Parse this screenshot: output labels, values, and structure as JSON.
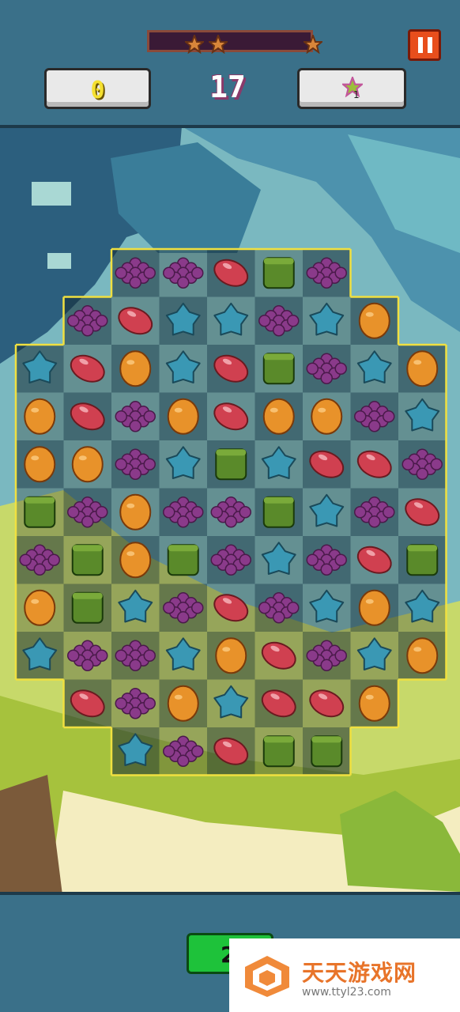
{
  "hud": {
    "coins": "0",
    "moves_left": "17",
    "booster_count": "1",
    "stars_total": 3
  },
  "board": {
    "rows": [
      [
        "",
        "",
        "grape",
        "grape",
        "bean",
        "square",
        "grape",
        "",
        ""
      ],
      [
        "",
        "grape",
        "bean",
        "star",
        "star",
        "grape",
        "star",
        "orange",
        ""
      ],
      [
        "star",
        "bean",
        "orange",
        "star",
        "bean",
        "square",
        "grape",
        "star",
        "orange"
      ],
      [
        "orange",
        "bean",
        "grape",
        "orange",
        "bean",
        "orange",
        "orange",
        "grape",
        "star"
      ],
      [
        "orange",
        "orange",
        "grape",
        "star",
        "square",
        "star",
        "bean",
        "bean",
        "grape"
      ],
      [
        "square",
        "grape",
        "orange",
        "grape",
        "grape",
        "square",
        "star",
        "grape",
        "bean"
      ],
      [
        "grape",
        "square",
        "orange",
        "square",
        "grape",
        "star",
        "grape",
        "bean",
        "square"
      ],
      [
        "orange",
        "square",
        "star",
        "grape",
        "bean",
        "grape",
        "star",
        "orange",
        "star"
      ],
      [
        "star",
        "grape",
        "grape",
        "star",
        "orange",
        "bean",
        "grape",
        "star",
        "orange"
      ],
      [
        "",
        "bean",
        "grape",
        "orange",
        "star",
        "bean",
        "bean",
        "orange",
        ""
      ],
      [
        "",
        "",
        "star",
        "grape",
        "bean",
        "square",
        "square",
        "",
        ""
      ]
    ],
    "candy_colors": {
      "grape": "#8a3a8a",
      "bean": "#d04050",
      "star": "#3a98b4",
      "orange": "#e8922a",
      "square": "#5a8a2a"
    },
    "border_color": "#f0e040"
  },
  "bottom": {
    "button_label": "2"
  },
  "watermark": {
    "title": "天天游戏网",
    "url": "www.ttyl23.com"
  }
}
